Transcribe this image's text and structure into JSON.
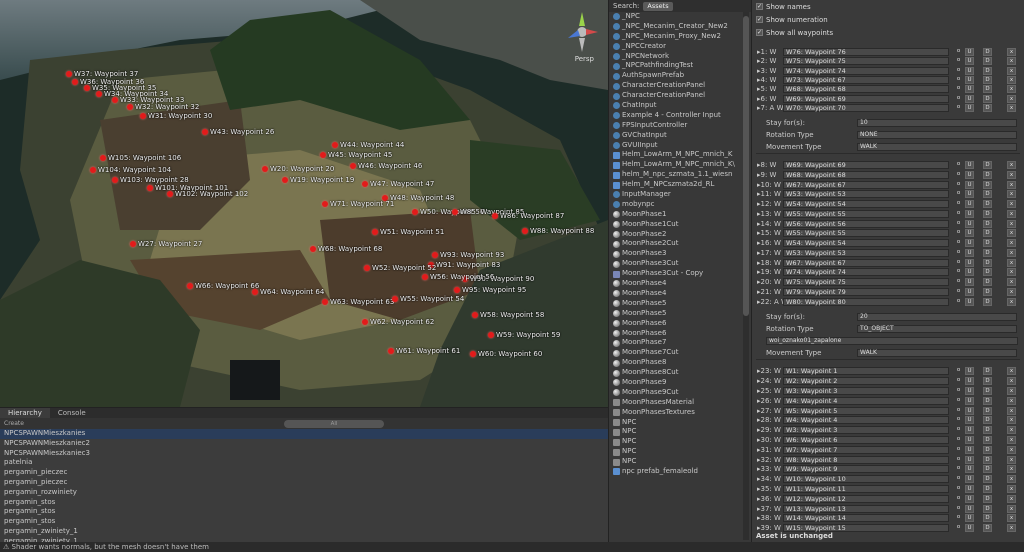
{
  "scene": {
    "label": "Persp",
    "waypoints": [
      "W37: Waypoint 37",
      "W36: Waypoint 36",
      "W35: Waypoint 35",
      "W34: Waypoint 34",
      "W33: Waypoint 33",
      "W32: Waypoint 32",
      "W31: Waypoint 30",
      "W43: Waypoint 26",
      "W44: Waypoint 44",
      "W45: Waypoint 45",
      "W46: Waypoint 46",
      "W105: Waypoint 106",
      "W104: Waypoint 104",
      "W103: Waypoint 28",
      "W101: Waypoint 101",
      "W102: Waypoint 102",
      "W20: Waypoint 20",
      "W19: Waypoint 19",
      "W47: Waypoint 47",
      "W48: Waypoint 48",
      "W71: Waypoint 71",
      "W50: Waypoint 50",
      "W85: Waypoint 85",
      "W86: Waypoint 87",
      "W88: Waypoint 88",
      "W51: Waypoint 51",
      "W27: Waypoint 27",
      "W68: Waypoint 68",
      "W93: Waypoint 93",
      "W91: Waypoint 83",
      "W52: Waypoint 52",
      "W90: Waypoint 90",
      "W95: Waypoint 95",
      "W66: Waypoint 66",
      "W64: Waypoint 64",
      "W56: Waypoint 56",
      "W63: Waypoint 63",
      "W55: Waypoint 54",
      "W58: Waypoint 58",
      "W62: Waypoint 62",
      "W59: Waypoint 59",
      "W61: Waypoint 61",
      "W60: Waypoint 60"
    ]
  },
  "hierarchy": {
    "tabs": [
      "Hierarchy",
      "Console"
    ],
    "create_label": "Create",
    "search_label": "All",
    "items": [
      "NPCSPAWNMieszkanies",
      "NPCSPAWNMieszkaniec2",
      "NPCSPAWNMieszkaniec3",
      "patelnia",
      "pergamin_pieczec",
      "pergamin_pieczec",
      "pergamin_rozwiniety",
      "pergamin_stos",
      "pergamin_stos",
      "pergamin_stos",
      "pergamin_zwiniety_1",
      "pergamin_zwiniety_1"
    ]
  },
  "status_message": "Shader wants normals, but the mesh   doesn't have them",
  "assets": {
    "search_label": "Search:",
    "filter_label": "Assets",
    "items": [
      {
        "name": "_NPC",
        "icon": "script"
      },
      {
        "name": "_NPC_Mecanim_Creator_New2",
        "icon": "script"
      },
      {
        "name": "_NPC_Mecanim_Proxy_New2",
        "icon": "script"
      },
      {
        "name": "_NPCCreator",
        "icon": "script"
      },
      {
        "name": "_NPCNetwork",
        "icon": "script"
      },
      {
        "name": "_NPCPathfindingTest",
        "icon": "script"
      },
      {
        "name": "AuthSpawnPrefab",
        "icon": "script"
      },
      {
        "name": "CharacterCreationPanel",
        "icon": "script"
      },
      {
        "name": "CharacterCreationPanel",
        "icon": "script"
      },
      {
        "name": "ChatInput",
        "icon": "script"
      },
      {
        "name": "Example 4 - Controller Input",
        "icon": "script"
      },
      {
        "name": "FPSInputController",
        "icon": "script"
      },
      {
        "name": "GVChatInput",
        "icon": "script"
      },
      {
        "name": "GVUIInput",
        "icon": "script"
      },
      {
        "name": "Helm_LowArm_M_NPC_mnich_K",
        "icon": "prefab"
      },
      {
        "name": "Helm_LowArm_M_NPC_mnich_K\\",
        "icon": "prefab"
      },
      {
        "name": "helm_M_npc_szmata_1.1_wiesn",
        "icon": "prefab"
      },
      {
        "name": "Helm_M_NPCszmata2d_RL",
        "icon": "prefab"
      },
      {
        "name": "InputManager",
        "icon": "script"
      },
      {
        "name": "mobynpc",
        "icon": "script"
      },
      {
        "name": "MoonPhase1",
        "icon": "moon"
      },
      {
        "name": "MoonPhase1Cut",
        "icon": "moon"
      },
      {
        "name": "MoonPhase2",
        "icon": "moon"
      },
      {
        "name": "MoonPhase2Cut",
        "icon": "moon"
      },
      {
        "name": "MoonPhase3",
        "icon": "moon"
      },
      {
        "name": "MoonPhase3Cut",
        "icon": "moon"
      },
      {
        "name": "MoonPhase3Cut - Copy",
        "icon": "tex"
      },
      {
        "name": "MoonPhase4",
        "icon": "moon"
      },
      {
        "name": "MoonPhase4",
        "icon": "moon"
      },
      {
        "name": "MoonPhase5",
        "icon": "moon"
      },
      {
        "name": "MoonPhase5",
        "icon": "moon"
      },
      {
        "name": "MoonPhase6",
        "icon": "moon"
      },
      {
        "name": "MoonPhase6",
        "icon": "moon"
      },
      {
        "name": "MoonPhase7",
        "icon": "moon"
      },
      {
        "name": "MoonPhase7Cut",
        "icon": "moon"
      },
      {
        "name": "MoonPhase8",
        "icon": "moon"
      },
      {
        "name": "MoonPhase8Cut",
        "icon": "moon"
      },
      {
        "name": "MoonPhase9",
        "icon": "moon"
      },
      {
        "name": "MoonPhase9Cut",
        "icon": "moon"
      },
      {
        "name": "MoonPhasesMaterial",
        "icon": "folder"
      },
      {
        "name": "MoonPhasesTextures",
        "icon": "folder"
      },
      {
        "name": "NPC",
        "icon": "folder"
      },
      {
        "name": "NPC",
        "icon": "folder"
      },
      {
        "name": "NPC",
        "icon": "folder"
      },
      {
        "name": "NPC",
        "icon": "folder"
      },
      {
        "name": "NPC",
        "icon": "folder"
      },
      {
        "name": "npc prefab_femaleold",
        "icon": "prefab"
      }
    ]
  },
  "inspector": {
    "options": [
      {
        "label": "Show names",
        "checked": true
      },
      {
        "label": "Show numeration",
        "checked": true
      },
      {
        "label": "Show all waypoints",
        "checked": true
      }
    ],
    "group1": [
      [
        "1:",
        "W",
        "W76: Waypoint 76"
      ],
      [
        "2:",
        "W",
        "W75: Waypoint 75"
      ],
      [
        "3:",
        "W",
        "W74: Waypoint 74"
      ],
      [
        "4:",
        "W",
        "W73: Waypoint 67"
      ],
      [
        "5:",
        "W",
        "W68: Waypoint 68"
      ],
      [
        "6:",
        "W",
        "W69: Waypoint 69"
      ],
      [
        "7:",
        "A W",
        "W70: Waypoint 70"
      ]
    ],
    "props1": {
      "stay_label": "Stay for(s):",
      "stay_value": "10",
      "rotation_label": "Rotation Type",
      "rotation_value": "NONE",
      "movement_label": "Movement Type",
      "movement_value": "WALK"
    },
    "group2": [
      [
        "8:",
        "W",
        "W69: Waypoint 69"
      ],
      [
        "9:",
        "W",
        "W68: Waypoint 68"
      ],
      [
        "10:",
        "W",
        "W67: Waypoint 67"
      ],
      [
        "11:",
        "W",
        "W53: Waypoint 53"
      ],
      [
        "12:",
        "W",
        "W54: Waypoint 54"
      ],
      [
        "13:",
        "W",
        "W55: Waypoint 55"
      ],
      [
        "14:",
        "W",
        "W56: Waypoint 56"
      ],
      [
        "15:",
        "W",
        "W55: Waypoint 55"
      ],
      [
        "16:",
        "W",
        "W54: Waypoint 54"
      ],
      [
        "17:",
        "W",
        "W53: Waypoint 53"
      ],
      [
        "18:",
        "W",
        "W67: Waypoint 67"
      ],
      [
        "19:",
        "W",
        "W74: Waypoint 74"
      ],
      [
        "20:",
        "W",
        "W75: Waypoint 75"
      ],
      [
        "21:",
        "W",
        "W79: Waypoint 79"
      ],
      [
        "22:",
        "A W",
        "W80: Waypoint 80"
      ]
    ],
    "props2": {
      "stay_label": "Stay for(s):",
      "stay_value": "20",
      "rotation_label": "Rotation Type",
      "rotation_value": "TO_OBJECT",
      "target_value": "woi_oznako01_zapalone",
      "movement_label": "Movement Type",
      "movement_value": "WALK"
    },
    "group3": [
      [
        "23:",
        "W",
        "W1: Waypoint 1"
      ],
      [
        "24:",
        "W",
        "W2: Waypoint 2"
      ],
      [
        "25:",
        "W",
        "W3: Waypoint 3"
      ],
      [
        "26:",
        "W",
        "W4: Waypoint 4"
      ],
      [
        "27:",
        "W",
        "W5: Waypoint 5"
      ],
      [
        "28:",
        "W",
        "W4: Waypoint 4"
      ],
      [
        "29:",
        "W",
        "W3: Waypoint 3"
      ],
      [
        "30:",
        "W",
        "W6: Waypoint 6"
      ],
      [
        "31:",
        "W",
        "W7: Waypoint 7"
      ],
      [
        "32:",
        "W",
        "W8: Waypoint 8"
      ],
      [
        "33:",
        "W",
        "W9: Waypoint 9"
      ],
      [
        "34:",
        "W",
        "W10: Waypoint 10"
      ],
      [
        "35:",
        "W",
        "W11: Waypoint 11"
      ],
      [
        "36:",
        "W",
        "W12: Waypoint 12"
      ],
      [
        "37:",
        "W",
        "W13: Waypoint 13"
      ],
      [
        "38:",
        "W",
        "W14: Waypoint 14"
      ],
      [
        "39:",
        "W",
        "W15: Waypoint 15"
      ]
    ],
    "button_labels": {
      "o": "o",
      "up": "U",
      "down": "D",
      "x": "x"
    },
    "status": "Asset is unchanged"
  }
}
